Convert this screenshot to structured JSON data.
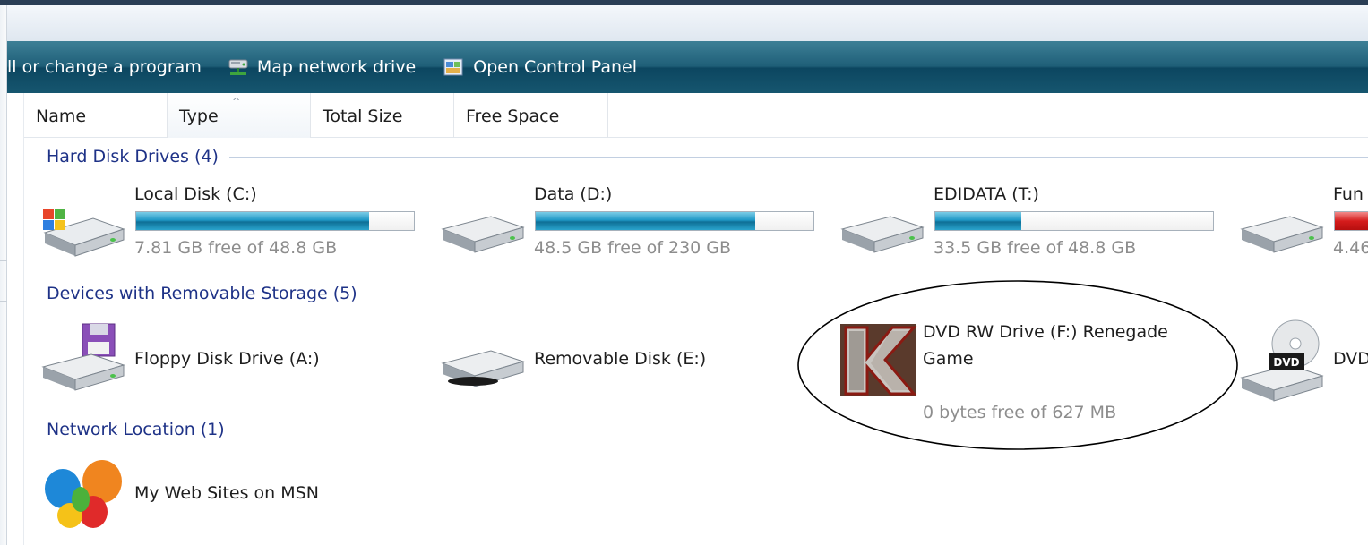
{
  "command_bar": {
    "items": [
      {
        "label": "ll or change a program",
        "icon": "none"
      },
      {
        "label": "Map network drive",
        "icon": "network-drive-icon"
      },
      {
        "label": "Open Control Panel",
        "icon": "control-panel-icon"
      }
    ]
  },
  "columns": {
    "name": "Name",
    "type": "Type",
    "total_size": "Total Size",
    "free_space": "Free Space",
    "sort_indicator": "^"
  },
  "groups": {
    "hard_disks": {
      "title": "Hard Disk Drives (4)",
      "items": [
        {
          "name": "Local Disk (C:)",
          "free": "7.81 GB free of 48.8 GB",
          "used_fraction": 0.84,
          "icon": "windows-drive-icon",
          "bar_color": "#1f98c6"
        },
        {
          "name": "Data (D:)",
          "free": "48.5 GB free of 230 GB",
          "used_fraction": 0.79,
          "icon": "hard-drive-icon",
          "bar_color": "#1f98c6"
        },
        {
          "name": "EDIDATA (T:)",
          "free": "33.5 GB free of 48.8 GB",
          "used_fraction": 0.31,
          "icon": "hard-drive-icon",
          "bar_color": "#1f98c6"
        },
        {
          "name": "Fun",
          "free": "4.46",
          "used_fraction": 0.95,
          "icon": "hard-drive-icon",
          "bar_color": "#d51c1c"
        }
      ]
    },
    "removable": {
      "title": "Devices with Removable Storage (5)",
      "items": [
        {
          "name": "Floppy Disk Drive (A:)",
          "icon": "floppy-drive-icon"
        },
        {
          "name": "Removable Disk (E:)",
          "icon": "removable-disk-icon"
        },
        {
          "name_line1": "DVD RW Drive (F:) Renegade",
          "name_line2": "Game",
          "free": "0 bytes free of 627 MB",
          "icon": "renegade-game-icon"
        },
        {
          "name": "DVD",
          "icon": "dvd-drive-icon",
          "badge": "DVD"
        }
      ]
    },
    "network": {
      "title": "Network Location (1)",
      "items": [
        {
          "name": "My Web Sites on MSN",
          "icon": "msn-butterfly-icon"
        }
      ]
    }
  },
  "colors": {
    "command_bar": "#1f5f78",
    "group_header_text": "#1e3287",
    "annotation_ellipse": "#000000"
  }
}
